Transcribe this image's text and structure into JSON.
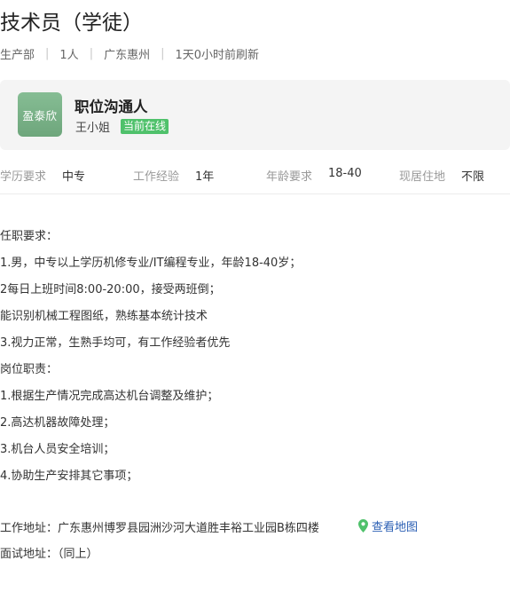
{
  "job": {
    "title": "技术员（学徒）",
    "meta": [
      "生产部",
      "1人",
      "广东惠州",
      "1天0小时前刷新"
    ]
  },
  "contact": {
    "logo_text": "盈泰欣",
    "heading": "职位沟通人",
    "name": "王小姐",
    "status": "当前在线"
  },
  "requirements": [
    {
      "label": "学历要求",
      "value": "中专"
    },
    {
      "label": "工作经验",
      "value": "1年"
    },
    {
      "label": "年龄要求",
      "value": "18-40"
    },
    {
      "label": "现居住地",
      "value": "不限"
    }
  ],
  "description": [
    "任职要求：",
    "1.男，中专以上学历机修专业/IT编程专业，年龄18-40岁；",
    "2每日上班时间8:00-20:00，接受两班倒；",
    "能识别机械工程图纸，熟练基本统计技术",
    "3.视力正常，生熟手均可，有工作经验者优先",
    "岗位职责：",
    "1.根据生产情况完成高达机台调整及维护；",
    "2.高达机器故障处理；",
    "3.机台人员安全培训；",
    "4.协助生产安排其它事项；"
  ],
  "address": {
    "work": "工作地址：广东惠州博罗县园洲沙河大道胜丰裕工业园B栋四楼",
    "map_link": "查看地图",
    "interview": "面试地址：（同上）"
  },
  "colors": {
    "online_badge": "#4fc16b",
    "link": "#2b5fb4",
    "pin": "#4fc16b"
  },
  "icons": {
    "map_pin": "map-pin-icon"
  }
}
